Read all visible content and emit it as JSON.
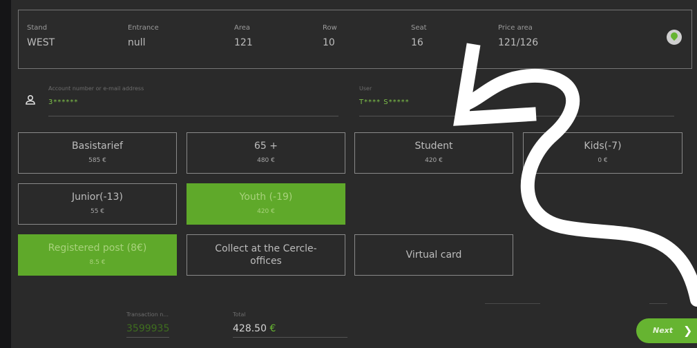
{
  "seat": {
    "stand_label": "Stand",
    "stand": "WEST",
    "entrance_label": "Entrance",
    "entrance": "null",
    "area_label": "Area",
    "area": "121",
    "row_label": "Row",
    "row": "10",
    "seat_label": "Seat",
    "seat": "16",
    "price_area_label": "Price area",
    "price_area": "121/126"
  },
  "account": {
    "label": "Account number or e-mail address",
    "value": "3******",
    "user_label": "User",
    "user_value": "T**** S*****"
  },
  "tariffs": [
    {
      "name": "Basistarief",
      "price": "585 €"
    },
    {
      "name": "65 +",
      "price": "480 €"
    },
    {
      "name": "Student",
      "price": "420 €"
    },
    {
      "name": "Kids(-7)",
      "price": "0 €"
    },
    {
      "name": "Junior(-13)",
      "price": "55 €"
    },
    {
      "name": "Youth (-19)",
      "price": "420 €"
    }
  ],
  "delivery": [
    {
      "name": "Registered post (8€)",
      "price": "8.5 €"
    },
    {
      "name": "Collect at the Cercle-offices"
    },
    {
      "name": "Virtual card"
    }
  ],
  "transaction": {
    "label": "Transaction n...",
    "value": "3599935"
  },
  "total": {
    "label": "Total",
    "value": "428.50",
    "currency": "€"
  },
  "next_label": "Next",
  "colors": {
    "accent": "#66b431",
    "panel": "#2a2a2a"
  }
}
